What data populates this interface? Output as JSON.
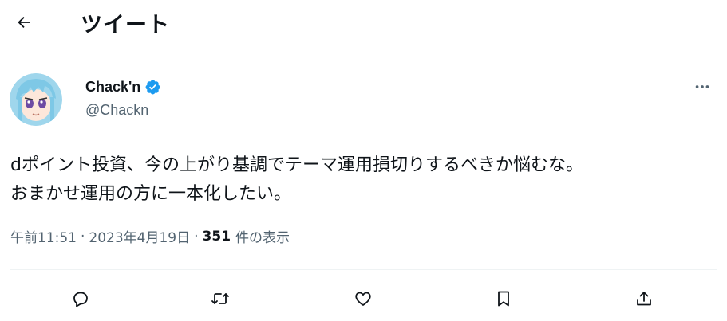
{
  "header": {
    "title": "ツイート",
    "back_icon": "arrow-left-icon"
  },
  "author": {
    "display_name": "Chack'n",
    "handle": "@Chackn",
    "verified": true,
    "verified_color": "#1d9bf0"
  },
  "tweet": {
    "text_line1": "dポイント投資、今の上がり基調でテーマ運用損切りするべきか悩むな。",
    "text_line2": "おまかせ運用の方に一本化したい。"
  },
  "meta": {
    "time": "午前11:51",
    "separator": "·",
    "date": "2023年4月19日",
    "views_count": "351",
    "views_label": "件の表示"
  },
  "actions": [
    {
      "name": "reply",
      "icon": "reply-icon"
    },
    {
      "name": "retweet",
      "icon": "retweet-icon"
    },
    {
      "name": "like",
      "icon": "heart-icon"
    },
    {
      "name": "bookmark",
      "icon": "bookmark-icon"
    },
    {
      "name": "share",
      "icon": "share-icon"
    }
  ],
  "colors": {
    "text": "#0f1419",
    "secondary": "#536471",
    "divider": "#eff3f4"
  }
}
